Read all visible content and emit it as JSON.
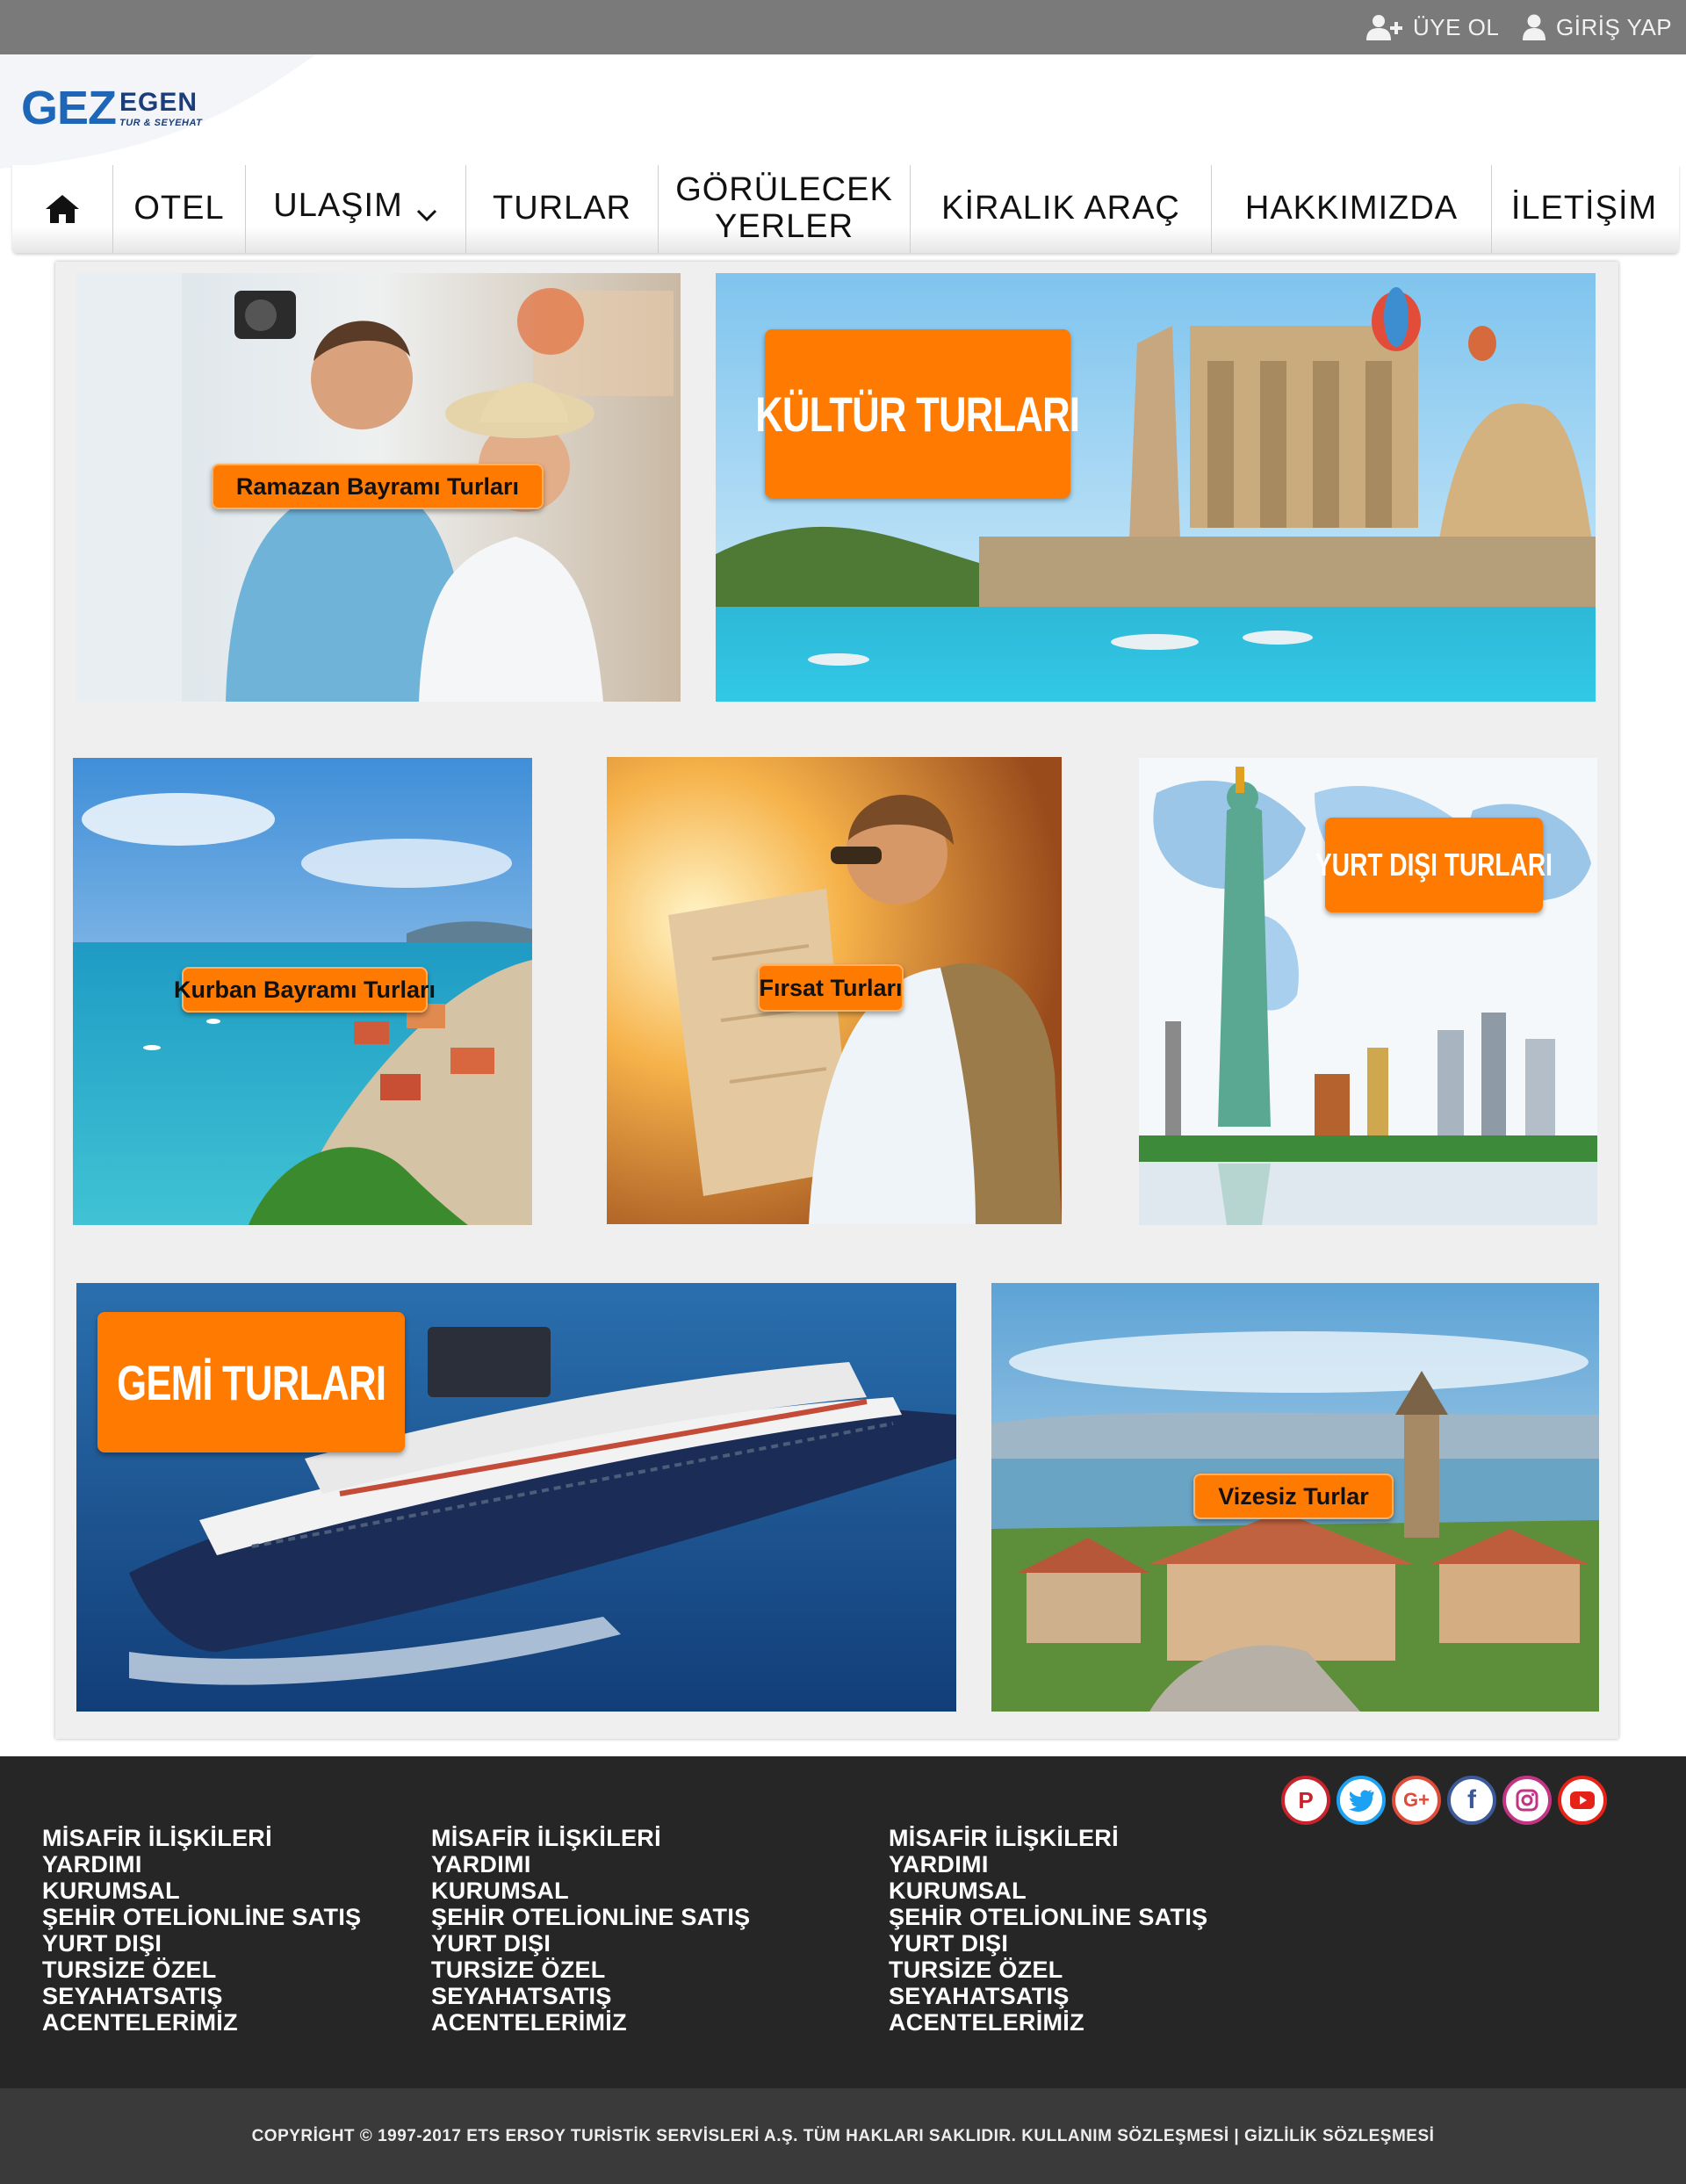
{
  "account": {
    "register_label": "ÜYE OL",
    "login_label": "GİRİŞ YAP",
    "register_icon": "user-plus-icon",
    "login_icon": "user-icon"
  },
  "logo": {
    "brand": "GEZ",
    "brand_suffix": "EGEN",
    "tagline": "TUR & SEYEHAT"
  },
  "nav": {
    "home_icon": "home-icon",
    "items": [
      "OTEL",
      "ULAŞIM",
      "TURLAR",
      "GÖRÜLECEK YERLER",
      "KİRALIK ARAÇ",
      "HAKKIMIZDA",
      "İLETİŞİM"
    ],
    "dropdown_icon": "chevron-down-icon"
  },
  "tiles": [
    {
      "label": "Ramazan Bayramı Turları"
    },
    {
      "label": "KÜLTÜR TURLARI"
    },
    {
      "label": "Kurban Bayramı Turları"
    },
    {
      "label": "Fırsat Turları"
    },
    {
      "label": "YURT DIŞI TURLARI"
    },
    {
      "label": "GEMİ TURLARI"
    },
    {
      "label": "Vizesiz Turlar"
    }
  ],
  "social": [
    "pinterest-icon",
    "twitter-icon",
    "google-plus-icon",
    "facebook-icon",
    "instagram-icon",
    "youtube-icon"
  ],
  "footer": {
    "columns": [
      [
        "MİSAFİR İLİŞKİLERİ",
        "YARDIMI",
        "KURUMSAL",
        "ŞEHİR OTELİONLİNE SATIŞ",
        "YURT DIŞI",
        "TURSİZE ÖZEL",
        "SEYAHATSATIŞ",
        "ACENTELERİMİZ"
      ],
      [
        "MİSAFİR İLİŞKİLERİ",
        "YARDIMI",
        "KURUMSAL",
        "ŞEHİR OTELİONLİNE SATIŞ",
        "YURT DIŞI",
        "TURSİZE ÖZEL",
        "SEYAHATSATIŞ",
        "ACENTELERİMİZ"
      ],
      [
        "MİSAFİR İLİŞKİLERİ",
        "YARDIMI",
        "KURUMSAL",
        "ŞEHİR OTELİONLİNE SATIŞ",
        "YURT DIŞI",
        "TURSİZE ÖZEL",
        "SEYAHATSATIŞ",
        "ACENTELERİMİZ"
      ]
    ],
    "copyright": "COPYRİGHT © 1997-2017 ETS ERSOY TURİSTİK SERVİSLERİ A.Ş. TÜM HAKLARI SAKLIDIR. KULLANIM SÖZLEŞMESİ | GİZLİLİK SÖZLEŞMESİ"
  },
  "colors": {
    "accent": "#ff7a00",
    "brand": "#1e67b8",
    "topbar": "#7a7a7a",
    "footer": "#262626"
  }
}
